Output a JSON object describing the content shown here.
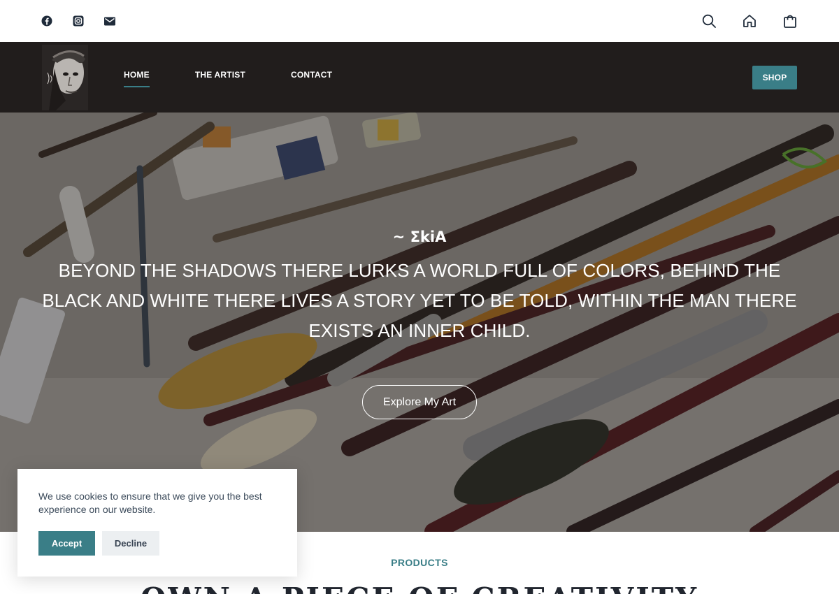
{
  "topbar": {
    "social_icons": [
      "facebook-icon",
      "instagram-icon",
      "mail-icon"
    ],
    "tool_icons": [
      "search-icon",
      "home-icon",
      "shopping-bag-icon"
    ]
  },
  "header": {
    "logo_alt": "ΣkiA portrait logo",
    "nav": [
      {
        "label": "HOME",
        "active": true
      },
      {
        "label": "THE ARTIST",
        "active": false
      },
      {
        "label": "CONTACT",
        "active": false
      }
    ],
    "shop_label": "SHOP"
  },
  "hero": {
    "subtitle": "~ ΣkiA",
    "title": "BEYOND THE SHADOWS THERE LURKS A WORLD FULL OF COLORS, BEHIND THE BLACK AND WHITE THERE LIVES A STORY YET TO BE TOLD, WITHIN THE MAN THERE EXISTS AN INNER CHILD.",
    "cta_label": "Explore My Art"
  },
  "cookie": {
    "message": "We use cookies to ensure that we give you the best experience on our website.",
    "accept_label": "Accept",
    "decline_label": "Decline"
  },
  "products": {
    "label": "PRODUCTS",
    "heading": "OWN A PIECE OF CREATIVITY"
  },
  "colors": {
    "accent": "#3a7e87",
    "header_bg": "#211d1c",
    "text_dark": "#21262f"
  }
}
